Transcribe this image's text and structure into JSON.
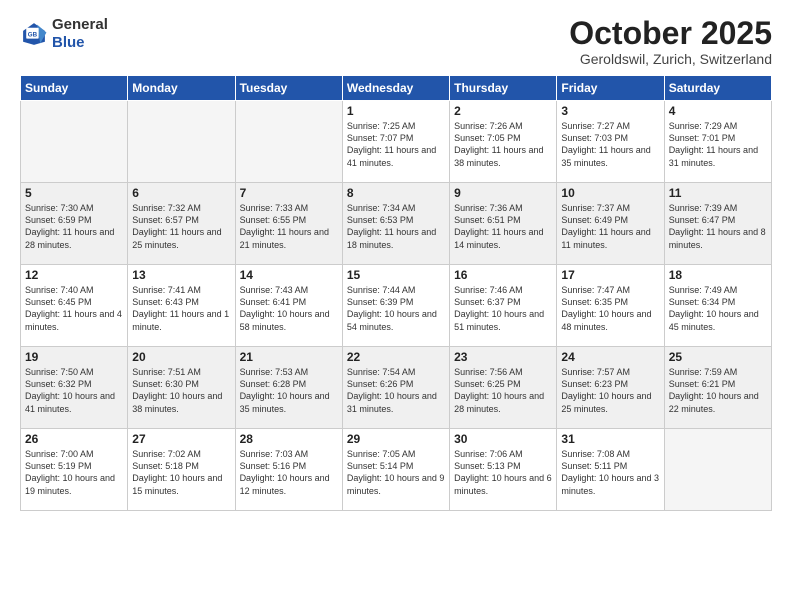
{
  "logo": {
    "general": "General",
    "blue": "Blue"
  },
  "title": "October 2025",
  "subtitle": "Geroldswil, Zurich, Switzerland",
  "days_of_week": [
    "Sunday",
    "Monday",
    "Tuesday",
    "Wednesday",
    "Thursday",
    "Friday",
    "Saturday"
  ],
  "weeks": [
    [
      {
        "day": "",
        "empty": true
      },
      {
        "day": "",
        "empty": true
      },
      {
        "day": "",
        "empty": true
      },
      {
        "day": "1",
        "sunrise": "7:25 AM",
        "sunset": "7:07 PM",
        "daylight": "11 hours and 41 minutes."
      },
      {
        "day": "2",
        "sunrise": "7:26 AM",
        "sunset": "7:05 PM",
        "daylight": "11 hours and 38 minutes."
      },
      {
        "day": "3",
        "sunrise": "7:27 AM",
        "sunset": "7:03 PM",
        "daylight": "11 hours and 35 minutes."
      },
      {
        "day": "4",
        "sunrise": "7:29 AM",
        "sunset": "7:01 PM",
        "daylight": "11 hours and 31 minutes."
      }
    ],
    [
      {
        "day": "5",
        "sunrise": "7:30 AM",
        "sunset": "6:59 PM",
        "daylight": "11 hours and 28 minutes."
      },
      {
        "day": "6",
        "sunrise": "7:32 AM",
        "sunset": "6:57 PM",
        "daylight": "11 hours and 25 minutes."
      },
      {
        "day": "7",
        "sunrise": "7:33 AM",
        "sunset": "6:55 PM",
        "daylight": "11 hours and 21 minutes."
      },
      {
        "day": "8",
        "sunrise": "7:34 AM",
        "sunset": "6:53 PM",
        "daylight": "11 hours and 18 minutes."
      },
      {
        "day": "9",
        "sunrise": "7:36 AM",
        "sunset": "6:51 PM",
        "daylight": "11 hours and 14 minutes."
      },
      {
        "day": "10",
        "sunrise": "7:37 AM",
        "sunset": "6:49 PM",
        "daylight": "11 hours and 11 minutes."
      },
      {
        "day": "11",
        "sunrise": "7:39 AM",
        "sunset": "6:47 PM",
        "daylight": "11 hours and 8 minutes."
      }
    ],
    [
      {
        "day": "12",
        "sunrise": "7:40 AM",
        "sunset": "6:45 PM",
        "daylight": "11 hours and 4 minutes."
      },
      {
        "day": "13",
        "sunrise": "7:41 AM",
        "sunset": "6:43 PM",
        "daylight": "11 hours and 1 minute."
      },
      {
        "day": "14",
        "sunrise": "7:43 AM",
        "sunset": "6:41 PM",
        "daylight": "10 hours and 58 minutes."
      },
      {
        "day": "15",
        "sunrise": "7:44 AM",
        "sunset": "6:39 PM",
        "daylight": "10 hours and 54 minutes."
      },
      {
        "day": "16",
        "sunrise": "7:46 AM",
        "sunset": "6:37 PM",
        "daylight": "10 hours and 51 minutes."
      },
      {
        "day": "17",
        "sunrise": "7:47 AM",
        "sunset": "6:35 PM",
        "daylight": "10 hours and 48 minutes."
      },
      {
        "day": "18",
        "sunrise": "7:49 AM",
        "sunset": "6:34 PM",
        "daylight": "10 hours and 45 minutes."
      }
    ],
    [
      {
        "day": "19",
        "sunrise": "7:50 AM",
        "sunset": "6:32 PM",
        "daylight": "10 hours and 41 minutes."
      },
      {
        "day": "20",
        "sunrise": "7:51 AM",
        "sunset": "6:30 PM",
        "daylight": "10 hours and 38 minutes."
      },
      {
        "day": "21",
        "sunrise": "7:53 AM",
        "sunset": "6:28 PM",
        "daylight": "10 hours and 35 minutes."
      },
      {
        "day": "22",
        "sunrise": "7:54 AM",
        "sunset": "6:26 PM",
        "daylight": "10 hours and 31 minutes."
      },
      {
        "day": "23",
        "sunrise": "7:56 AM",
        "sunset": "6:25 PM",
        "daylight": "10 hours and 28 minutes."
      },
      {
        "day": "24",
        "sunrise": "7:57 AM",
        "sunset": "6:23 PM",
        "daylight": "10 hours and 25 minutes."
      },
      {
        "day": "25",
        "sunrise": "7:59 AM",
        "sunset": "6:21 PM",
        "daylight": "10 hours and 22 minutes."
      }
    ],
    [
      {
        "day": "26",
        "sunrise": "7:00 AM",
        "sunset": "5:19 PM",
        "daylight": "10 hours and 19 minutes."
      },
      {
        "day": "27",
        "sunrise": "7:02 AM",
        "sunset": "5:18 PM",
        "daylight": "10 hours and 15 minutes."
      },
      {
        "day": "28",
        "sunrise": "7:03 AM",
        "sunset": "5:16 PM",
        "daylight": "10 hours and 12 minutes."
      },
      {
        "day": "29",
        "sunrise": "7:05 AM",
        "sunset": "5:14 PM",
        "daylight": "10 hours and 9 minutes."
      },
      {
        "day": "30",
        "sunrise": "7:06 AM",
        "sunset": "5:13 PM",
        "daylight": "10 hours and 6 minutes."
      },
      {
        "day": "31",
        "sunrise": "7:08 AM",
        "sunset": "5:11 PM",
        "daylight": "10 hours and 3 minutes."
      },
      {
        "day": "",
        "empty": true
      }
    ]
  ]
}
